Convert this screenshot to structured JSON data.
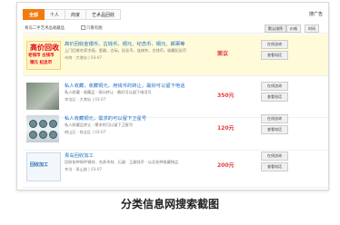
{
  "tabs": [
    "全部",
    "个人",
    "商家",
    "艺术品回收"
  ],
  "top_right": "搜广告",
  "filter": {
    "label": "青岛二手艺术品收藏品",
    "checkbox": "只看有图",
    "sort": [
      "默认排序",
      "价格",
      "时间"
    ]
  },
  "items": [
    {
      "title": "高价回收金银币、古钱币、铜元、纪念币、钢元、邮票等",
      "desc": "上门回收名家字画，瓷器，古玩，纪念币，连体钞，古钱币，收藏纪念币",
      "meta": "市南 · 大港站 | 03-07",
      "price": "面议",
      "thumb": [
        "高价回收",
        "老钱币 古钱币",
        "铜元 纪念币"
      ],
      "buttons": [
        "在线咨询",
        "查看电话"
      ]
    },
    {
      "title": "私人收藏，收藏铜元，用钱币的转让，最好可以留下电话",
      "desc": "私人收藏 · 收藏品 · 铜元转让 · 最好可以留下电话号",
      "meta": "李沧区 · 大港站 | 03-07",
      "price": "350元",
      "buttons": [
        "在线咨询",
        "查看电话"
      ]
    },
    {
      "title": "私人收藏铜元，需求的可以留下卫星号",
      "desc": "私人收藏品转让 · 需求的可以留下卫星号",
      "meta": "崂山区 · 商业区 | 03-07",
      "price": "120元",
      "buttons": [
        "在线咨询",
        "查看电话"
      ]
    },
    {
      "title": "青岛回收加工",
      "desc": "回收各种铜件钢材、名贵木材、石器 · 王器钱币 · 以及各种收藏物品",
      "meta": "李沧 · 青山路 | 03-07",
      "price": "200元",
      "thumb": [
        "回收加工"
      ],
      "buttons": [
        "在线咨询",
        "查看电话"
      ]
    }
  ],
  "caption": "分类信息网搜索截图"
}
